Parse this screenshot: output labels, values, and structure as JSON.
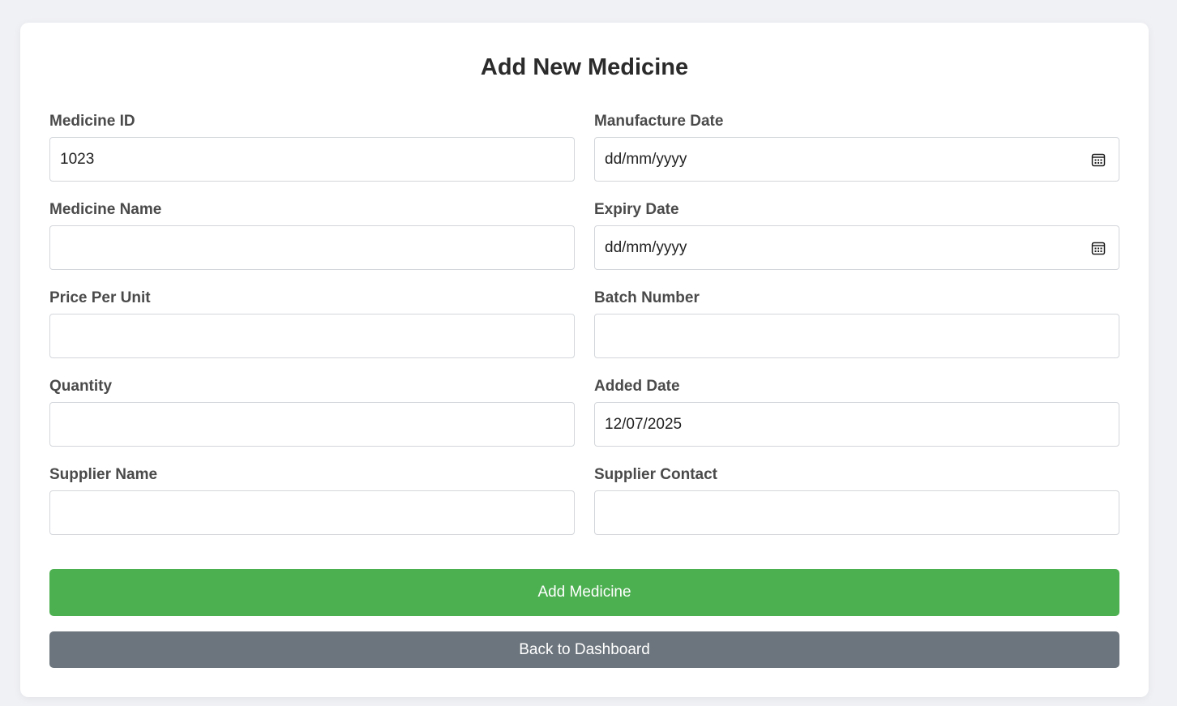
{
  "form": {
    "title": "Add New Medicine",
    "fields": [
      {
        "label": "Medicine ID",
        "value": "1023",
        "type": "text"
      },
      {
        "label": "Manufacture Date",
        "value": "dd/mm/yyyy",
        "type": "date"
      },
      {
        "label": "Medicine Name",
        "value": "",
        "type": "text"
      },
      {
        "label": "Expiry Date",
        "value": "dd/mm/yyyy",
        "type": "date"
      },
      {
        "label": "Price Per Unit",
        "value": "",
        "type": "text"
      },
      {
        "label": "Batch Number",
        "value": "",
        "type": "text"
      },
      {
        "label": "Quantity",
        "value": "",
        "type": "text"
      },
      {
        "label": "Added Date",
        "value": "12/07/2025",
        "type": "text"
      },
      {
        "label": "Supplier Name",
        "value": "",
        "type": "text"
      },
      {
        "label": "Supplier Contact",
        "value": "",
        "type": "text"
      }
    ],
    "add_button_label": "Add Medicine",
    "back_button_label": "Back to Dashboard",
    "icons": {
      "date_picker": "calendar-icon"
    }
  },
  "colors": {
    "background": "#f0f1f5",
    "card": "#ffffff",
    "primary_button": "#4caf50",
    "secondary_button": "#6c757d"
  }
}
